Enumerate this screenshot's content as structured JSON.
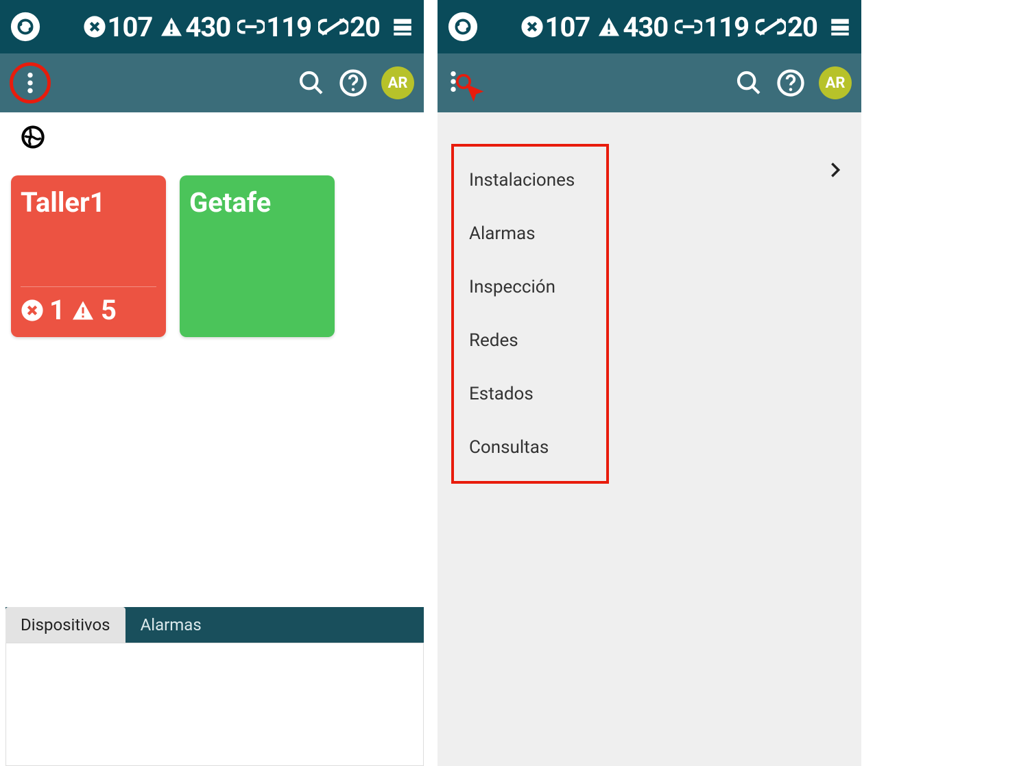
{
  "status": {
    "errors": "107",
    "warnings": "430",
    "linked": "119",
    "unlinked": "20"
  },
  "user": {
    "initials": "AR"
  },
  "left": {
    "cards": [
      {
        "title": "Taller1",
        "errors": "1",
        "warnings": "5"
      },
      {
        "title": "Getafe"
      }
    ],
    "tabs": {
      "active": "Dispositivos",
      "inactive": "Alarmas"
    }
  },
  "right": {
    "menu": [
      "Instalaciones",
      "Alarmas",
      "Inspección",
      "Redes",
      "Estados",
      "Consultas"
    ]
  }
}
